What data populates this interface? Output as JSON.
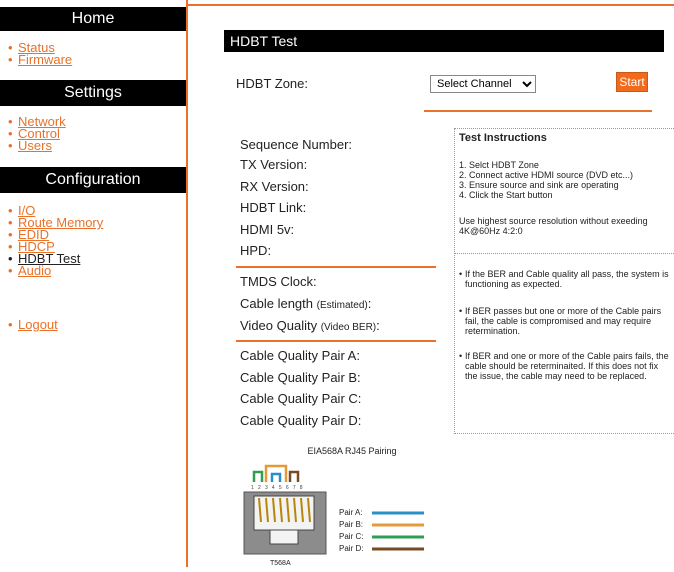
{
  "sidebar": {
    "home_header": "Home",
    "home_items": [
      "Status",
      "Firmware"
    ],
    "settings_header": "Settings",
    "settings_items": [
      "Network",
      "Control",
      "Users"
    ],
    "config_header": "Configuration",
    "config_items": [
      "I/O",
      "Route Memory",
      "EDID",
      "HDCP",
      "HDBT Test",
      "Audio"
    ],
    "active_item": "HDBT Test",
    "logout": "Logout"
  },
  "main": {
    "title": "HDBT Test",
    "zone_label": "HDBT Zone:",
    "zone_select_value": "Select Channel",
    "start_label": "Start",
    "fields": {
      "sequence": "Sequence Number:",
      "tx": "TX Version:",
      "rx": "RX Version:",
      "link": "HDBT Link:",
      "hdmi5v": "HDMI 5v:",
      "hpd": "HPD:",
      "tmds": "TMDS Clock:",
      "cable_len": "Cable length",
      "cable_len_note": "(Estimated)",
      "video_quality": "Video Quality",
      "video_quality_note": "(Video BER)",
      "pair_a": "Cable Quality Pair A:",
      "pair_b": "Cable Quality Pair B:",
      "pair_c": "Cable Quality Pair C:",
      "pair_d": "Cable Quality Pair D:"
    }
  },
  "instructions": {
    "title": "Test Instructions",
    "steps": [
      "1. Selct HDBT Zone",
      "2. Connect active HDMI source (DVD etc...)",
      "3. Ensure source and sink are operating",
      "4. Click the Start button"
    ],
    "note": "Use highest source resolution without exeeding 4K@60Hz 4:2:0",
    "bullets": [
      "If the BER and Cable quality all pass, the system is functioning as expected.",
      "If BER passes but one or more of the Cable pairs fail, the cable is compromised and may require retermination.",
      "If BER and one or more of the Cable pairs fails, the cable should be reterminaited. If this does not fix the issue, the cable may need to be replaced."
    ]
  },
  "diagram": {
    "title": "EIA568A RJ45 Pairing",
    "pin_numbers": "1 2 3 4 5 6 7 8",
    "pairs": [
      {
        "label": "Pair A:",
        "color": "#2a8fc9"
      },
      {
        "label": "Pair B:",
        "color": "#e39a3a"
      },
      {
        "label": "Pair C:",
        "color": "#2f9e52"
      },
      {
        "label": "Pair D:",
        "color": "#7a4a22"
      }
    ],
    "caption": "T568A"
  },
  "colors": {
    "accent": "#e8722a",
    "button": "#f26b1d"
  }
}
